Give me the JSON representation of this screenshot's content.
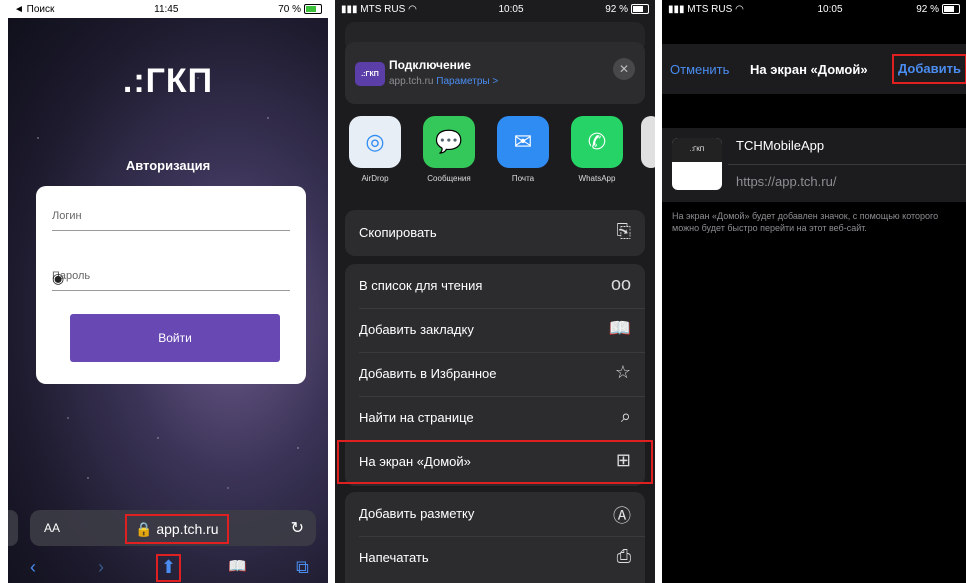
{
  "panel1": {
    "status": {
      "left": "◄ Поиск",
      "time": "11:45",
      "battery": "70 %"
    },
    "logo": ".:ГКП",
    "auth_title": "Авторизация",
    "login_placeholder": "Логин",
    "password_placeholder": "Пароль",
    "login_button": "Войти",
    "aa": "AA",
    "url": "🔒 app.tch.ru",
    "reload": "↻",
    "toolbar": {
      "back": "‹",
      "forward": "›",
      "share": "⬆",
      "bookmarks": "📖",
      "tabs": "⧉"
    }
  },
  "panel2": {
    "status": {
      "carrier": "MTS RUS",
      "time": "10:05",
      "battery": "92 %"
    },
    "header_title": "Подключение",
    "header_url": "app.tch.ru",
    "header_options": "Параметры >",
    "app_icon_text": ".:ГКП",
    "apps": [
      {
        "label": "AirDrop",
        "color": "#2f8cf3",
        "glyph": "◎"
      },
      {
        "label": "Сообщения",
        "color": "#34c759",
        "glyph": "💬"
      },
      {
        "label": "Почта",
        "color": "#2f8cf3",
        "glyph": "✉"
      },
      {
        "label": "WhatsApp",
        "color": "#25d366",
        "glyph": "✆"
      }
    ],
    "copy": "Скопировать",
    "actions": [
      {
        "label": "В список для чтения",
        "icon": "oo"
      },
      {
        "label": "Добавить закладку",
        "icon": "📖"
      },
      {
        "label": "Добавить в Избранное",
        "icon": "☆"
      },
      {
        "label": "Найти на странице",
        "icon": "⌕"
      },
      {
        "label": "На экран «Домой»",
        "icon": "⊞"
      }
    ],
    "more_actions": [
      {
        "label": "Добавить разметку",
        "icon": "Ⓐ"
      },
      {
        "label": "Напечатать",
        "icon": "⎙"
      }
    ]
  },
  "panel3": {
    "status": {
      "carrier": "MTS RUS",
      "time": "10:05",
      "battery": "92 %"
    },
    "cancel": "Отменить",
    "title": "На экран «Домой»",
    "add": "Добавить",
    "app_name": "TCHMobileApp",
    "app_url": "https://app.tch.ru/",
    "note": "На экран «Домой» будет добавлен значок, с помощью которого можно будет быстро перейти на этот веб-сайт.",
    "thumb_text": ".:ГКП"
  }
}
